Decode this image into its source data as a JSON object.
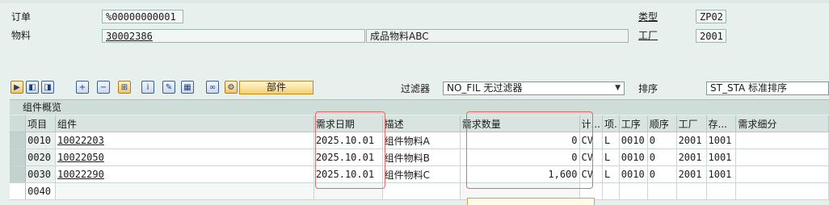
{
  "header": {
    "order_label": "订单",
    "order_value": "%00000000001",
    "material_label": "物料",
    "material_value": "30002386",
    "material_desc": "成品物料ABC",
    "type_label": "类型",
    "type_value": "ZP02",
    "plant_label": "工厂",
    "plant_value": "2001"
  },
  "toolbar": {
    "parts_label": "部件",
    "filter_label": "过滤器",
    "filter_value": "NO_FIL 无过滤器",
    "sort_label": "排序",
    "sort_value": "ST_STA 标准排序",
    "icons": [
      "bookmark-icon",
      "first-page-icon",
      "last-page-icon",
      "insert-row-icon",
      "delete-row-icon",
      "hierarchy-icon",
      "info-icon",
      "edit-icon",
      "table-settings-icon",
      "binoculars-icon",
      "filter-settings-icon"
    ]
  },
  "table": {
    "title": "组件概览",
    "headers": [
      "项目",
      "组件",
      "需求日期",
      "描述",
      "需求数量",
      "计...",
      "项.",
      "工序",
      "顺序",
      "工厂",
      "存...",
      "需求细分"
    ],
    "rows": [
      {
        "item": "0010",
        "component": "10022203",
        "date": "2025.10.01",
        "desc": "组件物料A",
        "qty": "0",
        "uom": "CV",
        "cat": "L",
        "op": "0010",
        "seq": "0",
        "plant": "2001",
        "sloc": "1001",
        "detail": ""
      },
      {
        "item": "0020",
        "component": "10022050",
        "date": "2025.10.01",
        "desc": "组件物料B",
        "qty": "0",
        "uom": "CV",
        "cat": "L",
        "op": "0010",
        "seq": "0",
        "plant": "2001",
        "sloc": "1001",
        "detail": ""
      },
      {
        "item": "0030",
        "component": "10022290",
        "date": "2025.10.01",
        "desc": "组件物料C",
        "qty": "1,600",
        "uom": "CV",
        "cat": "L",
        "op": "0010",
        "seq": "0",
        "plant": "2001",
        "sloc": "1001",
        "detail": ""
      },
      {
        "item": "0040",
        "component": "",
        "date": "",
        "desc": "",
        "qty": "",
        "uom": "",
        "cat": "",
        "op": "",
        "seq": "",
        "plant": "",
        "sloc": "",
        "detail": ""
      }
    ]
  },
  "colors": {
    "highlight": "#e06a6a",
    "background": "#e8f0ee"
  }
}
